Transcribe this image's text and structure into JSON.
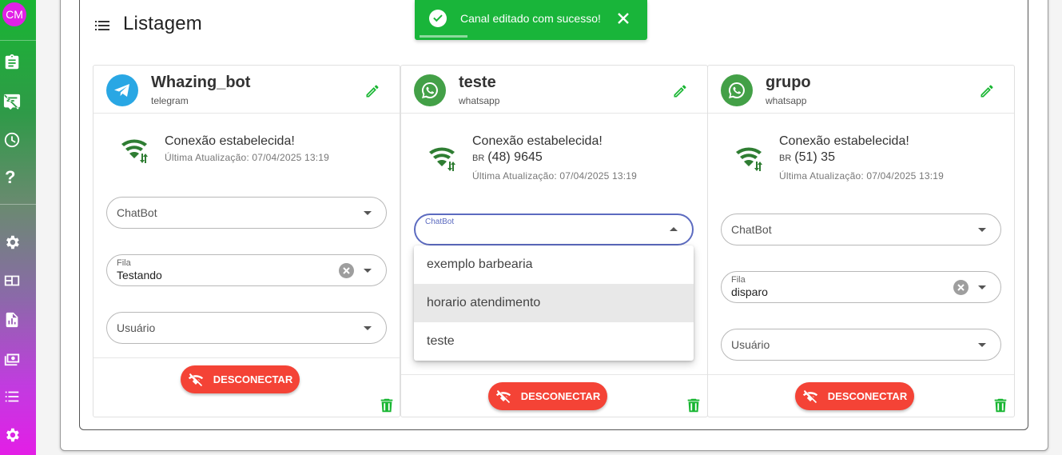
{
  "sidebar": {
    "avatar_initials": "CM",
    "icons": [
      "clipboard-icon",
      "message-off-icon",
      "clock-icon",
      "help-icon",
      "gear-icon",
      "dashboard-icon",
      "report-icon",
      "money-icon",
      "list-icon",
      "settings-icon"
    ],
    "help_glyph": "?"
  },
  "page": {
    "title": "Listagem"
  },
  "toast": {
    "message": "Canal editado com sucesso!",
    "color": "#19b53a"
  },
  "cards": [
    {
      "name": "Whazing_bot",
      "type": "telegram",
      "avatar_color": "#29a7e4",
      "icon": "telegram-icon",
      "status": "Conexão estabelecida!",
      "phone": "",
      "updated": "Última Atualização: 07/04/2025 13:19",
      "chatbot_placeholder": "ChatBot",
      "fila_label": "Fila",
      "fila_value": "Testando",
      "usuario_placeholder": "Usuário",
      "disconnect_label": "DESCONECTAR"
    },
    {
      "name": "teste",
      "type": "whatsapp",
      "avatar_color": "#43a047",
      "icon": "whatsapp-icon",
      "status": "Conexão estabelecida!",
      "phone_cc": "BR",
      "phone": "(48) 9645",
      "updated": "Última Atualização: 07/04/2025 13:19",
      "chatbot_label": "ChatBot",
      "disconnect_label": "DESCONECTAR"
    },
    {
      "name": "grupo",
      "type": "whatsapp",
      "avatar_color": "#43a047",
      "icon": "whatsapp-icon",
      "status": "Conexão estabelecida!",
      "phone_cc": "BR",
      "phone": "(51) 35",
      "updated": "Última Atualização: 07/04/2025 13:19",
      "chatbot_placeholder": "ChatBot",
      "fila_label": "Fila",
      "fila_value": "disparo",
      "usuario_placeholder": "Usuário",
      "disconnect_label": "DESCONECTAR"
    }
  ],
  "menu": {
    "options": [
      "exemplo barbearia",
      "horario atendimento",
      "teste"
    ],
    "highlighted": "horario atendimento"
  },
  "colors": {
    "accent_green": "#18b632",
    "danger": "#f44336",
    "focus": "#5c6bc0"
  }
}
